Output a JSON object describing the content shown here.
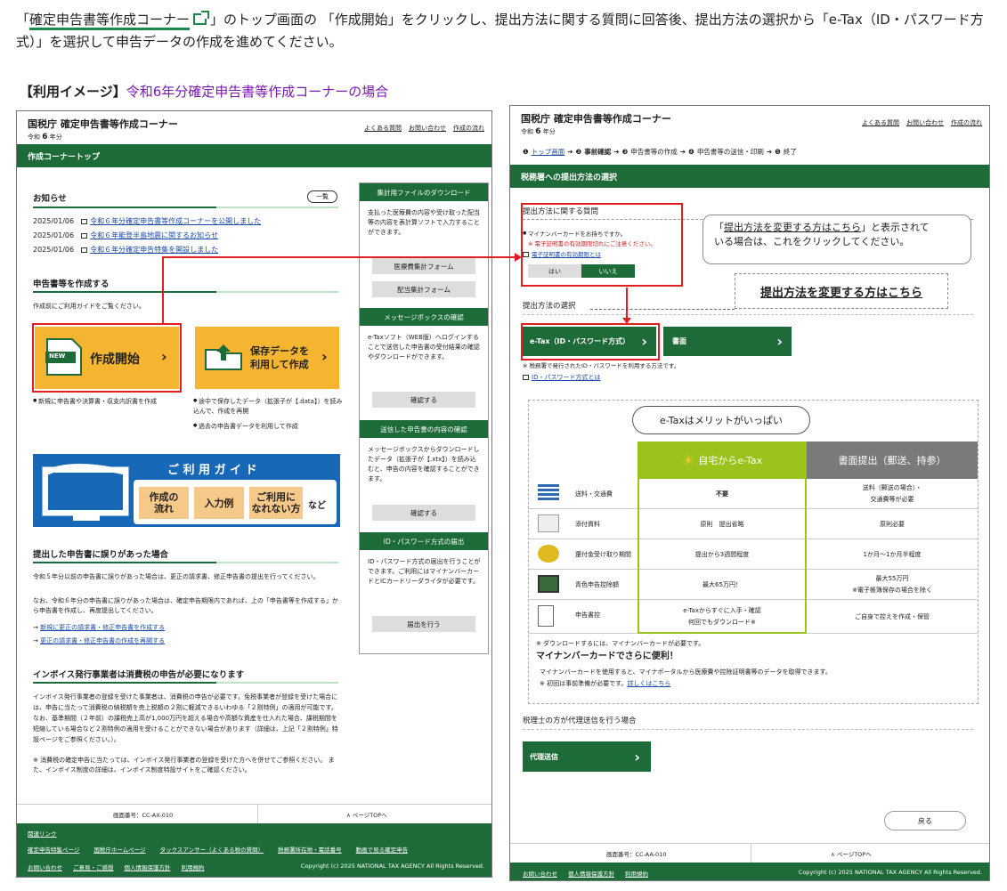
{
  "intro": {
    "q_open": "「",
    "link": "確定申告書等作成コーナー",
    "text1": "」のトップ画面の 「作成開始」をクリックし、提出方法に関する質問に回答後、提出方法の選択から「e-Tax（ID・パスワード方式）」を選択して申告データの作成を進めてください。"
  },
  "caption": {
    "prefix": "【利用イメージ】",
    "title": "令和6年分確定申告書等作成コーナーの場合"
  },
  "site": {
    "title": "国税庁 確定申告書等作成コーナー",
    "year_prefix": "令和",
    "year_num": "6",
    "year_suffix": "年分",
    "links": [
      "よくある質問",
      "お問い合わせ",
      "作成の流れ"
    ]
  },
  "left": {
    "bar": "作成コーナートップ",
    "news_title": "お知らせ",
    "news_all": "一覧",
    "news": [
      {
        "date": "2025/01/06",
        "text": "令和６年分確定申告書等作成コーナーを公開しました"
      },
      {
        "date": "2025/01/06",
        "text": "令和６年能登半島地震に関するお知らせ"
      },
      {
        "date": "2025/01/06",
        "text": "令和６年分確定申告特集を開設しました"
      }
    ],
    "create_title": "申告書等を作成する",
    "create_note": "作成前にご利用ガイドをご覧ください。",
    "start_badge": "NEW",
    "start_label": "作成開始",
    "resume_line1": "保存データを",
    "resume_line2": "利用して作成",
    "start_note": "新規に申告書や決算書・収支内訳書を作成",
    "resume_note1": "途中で保存したデータ（拡張子が【.data】）を読み込んで、作成を再開",
    "resume_note2": "過去の申告書データを利用して作成",
    "guide_title": "ご 利 用 ガ イ ド",
    "guide_chips": [
      "作成の\n流れ",
      "入力例",
      "ご利用に\nなれない方"
    ],
    "guide_etc": "など",
    "err_title": "提出した申告書に誤りがあった場合",
    "err_text1": "令和５年分以前の申告書に誤りがあった場合は、更正の請求書、修正申告書の提出を行ってください。",
    "err_text2": "なお、令和６年分の申告書に誤りがあった場合は、確定申告期限内であれば、上の「申告書等を作成する」から申告書を作成し、再度提出してください。",
    "err_link1": "新規に更正の請求書・修正申告書を作成する",
    "err_link2": "更正の請求書・修正申告書の作成を再開する",
    "inv_title": "インボイス発行事業者は消費税の申告が必要になります",
    "inv_text": "インボイス発行事業者の登録を受けた事業者は、消費税の申告が必要です。免税事業者が登録を受けた場合には、申告に当たって消費税の納税額を売上税額の２割に軽減できるいわゆる「２割特例」の適用が可能です。 なお、基準期間（２年前）の課税売上高が1,000万円を超える場合や高額な資産を仕入れた場合、課税期間を短縮している場合など２割特例の適用を受けることができない場合があります（詳細は、上記「２割特例」特設ページをご参照ください。）。",
    "inv_note": "※ 消費税の確定申告に当たっては、インボイス発行事業者の登録を受けた方へを併せてご参照ください。 また、インボイス制度の詳細は、インボイス制度特設サイトをご確認ください。",
    "page_no": "画面番号：CC-AX-010",
    "page_top": "∧ ページTOPへ",
    "side": [
      {
        "head": "集計用ファイルのダウンロード",
        "text": "支払った医療費の内容や受け取った配当等の内容を表計算ソフトで入力することができます。",
        "buttons": [
          "医療費集計フォーム",
          "配当集計フォーム"
        ]
      },
      {
        "head": "メッセージボックスの確認",
        "text": "e-Taxソフト（WEB版）へログインすることで送信した申告書の受付結果の確認やダウンロードができます。",
        "buttons": [
          "確認する"
        ]
      },
      {
        "head": "送信した申告書の内容の確認",
        "text": "メッセージボックスからダウンロードしたデータ（拡張子が【.xtx】）を読み込むと、申告の内容を確認することができます。",
        "buttons": [
          "確認する"
        ]
      },
      {
        "head": "ID・パスワード方式の届出",
        "text": "ID・パスワード方式の届出を行うことができます。ご利用にはマイナンバーカードとICカードリーダライタが必要です。",
        "buttons": [
          "届出を行う"
        ]
      }
    ],
    "footer_title": "関連リンク",
    "footer_links": [
      "確定申告特集ページ",
      "国税庁ホームページ",
      "タックスアンサー（よくある税の質問）",
      "税務署所在地・電話番号",
      "動画で見る確定申告"
    ],
    "footer_links2": [
      "お問い合わせ",
      "ご意見・ご感想",
      "個人情報保護方針",
      "利用規約"
    ],
    "copyright": "Copyright (c) 2025 NATIONAL TAX AGENCY All Rights Reserved."
  },
  "right": {
    "steps": [
      "トップ画面",
      "事前確認",
      "申告書等の作成",
      "申告書等の送信・印刷",
      "終了"
    ],
    "bar": "税務署への提出方法の選択",
    "q_title": "提出方法に関する質問",
    "q_text": "マイナンバーカードをお持ちですか。",
    "q_warn": "※ 電子証明書の有効期限切れにご注意ください。",
    "q_link": "電子証明書の有効期限とは",
    "yes": "はい",
    "no": "いいえ",
    "callout_link": "提出方法を変更する方はこちら",
    "callout_rest1": "」と表示されて",
    "callout_rest2": "いる場合は、これをクリックしてください。",
    "change_btn": "提出方法を変更する方はこちら",
    "method_title": "提出方法の選択",
    "etax_btn": "e-Tax（ID・パスワード方式）",
    "paper_btn": "書面",
    "etax_note": "※ 税務署で発行されたID・パスワードを利用する方法です。",
    "etax_link": "ID・パスワード方式とは",
    "bubble": "e-Taxはメリットがいっぱい",
    "col_etax": "自宅からe-Tax",
    "col_paper": "書面提出（郵送、持参）",
    "rows": [
      {
        "label": "送料・交通費",
        "etax": "不要",
        "paper": "送料（郵送の場合）・\n交通費等が必要"
      },
      {
        "label": "添付資料",
        "etax": "原則　提出省略",
        "paper": "原則必要"
      },
      {
        "label": "還付金受け取り期間",
        "etax": "提出から3週間程度",
        "paper": "1か月～1か月半程度"
      },
      {
        "label": "青色申告控除額",
        "etax": "最大65万円！",
        "paper": "最大55万円\n※電子帳簿保存の場合を除く"
      },
      {
        "label": "申告書控",
        "etax": "e-Taxからすぐに入手・確認\n何回でもダウンロード※",
        "paper": "ご自身で控えを作成・保管"
      }
    ],
    "dl_note": "※ ダウンロードするには、マイナンバーカードが必要です。",
    "mn_title": "マイナンバーカードでさらに便利！",
    "mn_text": "マイナンバーカードを使用すると、マイナポータルから医療費や控除証明書等のデータを取得できます。",
    "mn_note": "※ 初回は事前準備が必要です。",
    "mn_link": "詳しくはこちら",
    "agent_title": "税理士の方が代理送信を行う場合",
    "agent_btn": "代理送信",
    "back": "戻る",
    "page_no": "画面番号：CC-AA-010",
    "page_top": "∧ ページTOPへ",
    "footer_links": [
      "お問い合わせ",
      "個人情報保護方針",
      "利用規約"
    ],
    "copyright": "Copyright (c) 2025 NATIONAL TAX AGENCY All Rights Reserved."
  },
  "colors": {
    "green": "#1d6b38",
    "orange": "#f6b530",
    "red": "#e02020",
    "lime": "#9ac31c",
    "gray": "#7a7a7a"
  }
}
